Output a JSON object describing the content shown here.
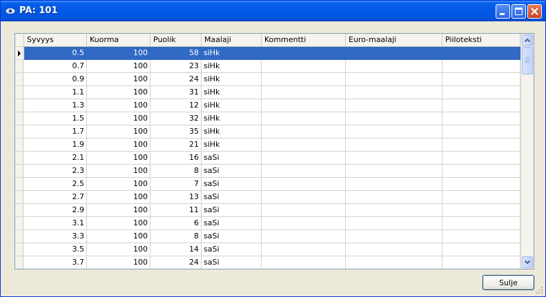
{
  "window": {
    "title": "PA: 101"
  },
  "grid": {
    "columns": [
      "Syvyys",
      "Kuorma",
      "Puolik",
      "Maalaji",
      "Kommentti",
      "Euro-maalaji",
      "Piiloteksti"
    ],
    "rows": [
      {
        "syvyys": "0.5",
        "kuorma": "100",
        "puolik": "58",
        "maalaji": "siHk",
        "kommentti": "",
        "euro": "",
        "piilo": ""
      },
      {
        "syvyys": "0.7",
        "kuorma": "100",
        "puolik": "23",
        "maalaji": "siHk",
        "kommentti": "",
        "euro": "",
        "piilo": ""
      },
      {
        "syvyys": "0.9",
        "kuorma": "100",
        "puolik": "24",
        "maalaji": "siHk",
        "kommentti": "",
        "euro": "",
        "piilo": ""
      },
      {
        "syvyys": "1.1",
        "kuorma": "100",
        "puolik": "31",
        "maalaji": "siHk",
        "kommentti": "",
        "euro": "",
        "piilo": ""
      },
      {
        "syvyys": "1.3",
        "kuorma": "100",
        "puolik": "12",
        "maalaji": "siHk",
        "kommentti": "",
        "euro": "",
        "piilo": ""
      },
      {
        "syvyys": "1.5",
        "kuorma": "100",
        "puolik": "32",
        "maalaji": "siHk",
        "kommentti": "",
        "euro": "",
        "piilo": ""
      },
      {
        "syvyys": "1.7",
        "kuorma": "100",
        "puolik": "35",
        "maalaji": "siHk",
        "kommentti": "",
        "euro": "",
        "piilo": ""
      },
      {
        "syvyys": "1.9",
        "kuorma": "100",
        "puolik": "21",
        "maalaji": "siHk",
        "kommentti": "",
        "euro": "",
        "piilo": ""
      },
      {
        "syvyys": "2.1",
        "kuorma": "100",
        "puolik": "16",
        "maalaji": "saSi",
        "kommentti": "",
        "euro": "",
        "piilo": ""
      },
      {
        "syvyys": "2.3",
        "kuorma": "100",
        "puolik": "8",
        "maalaji": "saSi",
        "kommentti": "",
        "euro": "",
        "piilo": ""
      },
      {
        "syvyys": "2.5",
        "kuorma": "100",
        "puolik": "7",
        "maalaji": "saSi",
        "kommentti": "",
        "euro": "",
        "piilo": ""
      },
      {
        "syvyys": "2.7",
        "kuorma": "100",
        "puolik": "13",
        "maalaji": "saSi",
        "kommentti": "",
        "euro": "",
        "piilo": ""
      },
      {
        "syvyys": "2.9",
        "kuorma": "100",
        "puolik": "11",
        "maalaji": "saSi",
        "kommentti": "",
        "euro": "",
        "piilo": ""
      },
      {
        "syvyys": "3.1",
        "kuorma": "100",
        "puolik": "6",
        "maalaji": "saSi",
        "kommentti": "",
        "euro": "",
        "piilo": ""
      },
      {
        "syvyys": "3.3",
        "kuorma": "100",
        "puolik": "8",
        "maalaji": "saSi",
        "kommentti": "",
        "euro": "",
        "piilo": ""
      },
      {
        "syvyys": "3.5",
        "kuorma": "100",
        "puolik": "14",
        "maalaji": "saSi",
        "kommentti": "",
        "euro": "",
        "piilo": ""
      },
      {
        "syvyys": "3.7",
        "kuorma": "100",
        "puolik": "24",
        "maalaji": "saSi",
        "kommentti": "",
        "euro": "",
        "piilo": ""
      }
    ],
    "selected_row": 0
  },
  "buttons": {
    "close_label": "Sulje"
  },
  "icons": {
    "app": "eye-icon",
    "minimize": "minimize-icon",
    "maximize": "maximize-icon",
    "close": "close-icon",
    "row_pointer": "row-pointer-icon",
    "scroll_up": "chevron-up-icon",
    "scroll_down": "chevron-down-icon",
    "grip": "resize-grip-icon"
  },
  "colors": {
    "selection": "#316ac5",
    "titlebar": "#0058e6",
    "window_bg": "#ece9d8"
  }
}
